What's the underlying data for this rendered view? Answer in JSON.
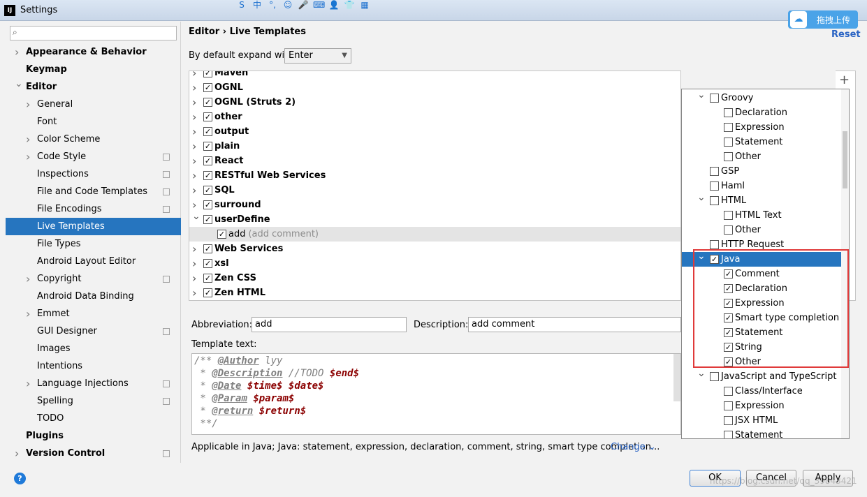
{
  "window": {
    "title": "Settings",
    "app_icon_text": "IJ",
    "ime_glyphs": [
      "S",
      "中",
      "°,",
      "☺",
      "🎤",
      "⌨",
      "👤",
      "👕",
      "▦"
    ],
    "upload_label": "拖拽上传"
  },
  "sidebar": {
    "search_placeholder": "",
    "items": [
      {
        "label": "Appearance & Behavior",
        "level": 0,
        "expand": "collapsed",
        "bold": true
      },
      {
        "label": "Keymap",
        "level": 0,
        "expand": "none",
        "bold": true
      },
      {
        "label": "Editor",
        "level": 0,
        "expand": "expanded",
        "bold": true
      },
      {
        "label": "General",
        "level": 1,
        "expand": "collapsed"
      },
      {
        "label": "Font",
        "level": 1,
        "expand": "none"
      },
      {
        "label": "Color Scheme",
        "level": 1,
        "expand": "collapsed"
      },
      {
        "label": "Code Style",
        "level": 1,
        "expand": "collapsed",
        "copy_icon": true
      },
      {
        "label": "Inspections",
        "level": 1,
        "expand": "none",
        "copy_icon": true
      },
      {
        "label": "File and Code Templates",
        "level": 1,
        "expand": "none",
        "copy_icon": true
      },
      {
        "label": "File Encodings",
        "level": 1,
        "expand": "none",
        "copy_icon": true
      },
      {
        "label": "Live Templates",
        "level": 1,
        "expand": "none",
        "selected": true
      },
      {
        "label": "File Types",
        "level": 1,
        "expand": "none"
      },
      {
        "label": "Android Layout Editor",
        "level": 1,
        "expand": "none"
      },
      {
        "label": "Copyright",
        "level": 1,
        "expand": "collapsed",
        "copy_icon": true
      },
      {
        "label": "Android Data Binding",
        "level": 1,
        "expand": "none"
      },
      {
        "label": "Emmet",
        "level": 1,
        "expand": "collapsed"
      },
      {
        "label": "GUI Designer",
        "level": 1,
        "expand": "none",
        "copy_icon": true
      },
      {
        "label": "Images",
        "level": 1,
        "expand": "none"
      },
      {
        "label": "Intentions",
        "level": 1,
        "expand": "none"
      },
      {
        "label": "Language Injections",
        "level": 1,
        "expand": "collapsed",
        "copy_icon": true
      },
      {
        "label": "Spelling",
        "level": 1,
        "expand": "none",
        "copy_icon": true
      },
      {
        "label": "TODO",
        "level": 1,
        "expand": "none"
      },
      {
        "label": "Plugins",
        "level": 0,
        "expand": "none",
        "bold": true
      },
      {
        "label": "Version Control",
        "level": 0,
        "expand": "collapsed",
        "bold": true,
        "copy_icon": true
      }
    ]
  },
  "main": {
    "breadcrumb": "Editor  ›  Live Templates",
    "reset_label": "Reset",
    "expand_label": "By default expand with",
    "expand_value": "Enter",
    "templates": [
      {
        "label": "Maven",
        "checked": true,
        "expand": "collapsed"
      },
      {
        "label": "OGNL",
        "checked": true,
        "expand": "collapsed"
      },
      {
        "label": "OGNL (Struts 2)",
        "checked": true,
        "expand": "collapsed"
      },
      {
        "label": "other",
        "checked": true,
        "expand": "collapsed"
      },
      {
        "label": "output",
        "checked": true,
        "expand": "collapsed"
      },
      {
        "label": "plain",
        "checked": true,
        "expand": "collapsed"
      },
      {
        "label": "React",
        "checked": true,
        "expand": "collapsed"
      },
      {
        "label": "RESTful Web Services",
        "checked": true,
        "expand": "collapsed"
      },
      {
        "label": "SQL",
        "checked": true,
        "expand": "collapsed"
      },
      {
        "label": "surround",
        "checked": true,
        "expand": "collapsed"
      },
      {
        "label": "userDefine",
        "checked": true,
        "expand": "expanded"
      },
      {
        "label": "add",
        "hint": "(add comment)",
        "checked": true,
        "child": true
      },
      {
        "label": "Web Services",
        "checked": true,
        "expand": "collapsed"
      },
      {
        "label": "xsl",
        "checked": true,
        "expand": "collapsed"
      },
      {
        "label": "Zen CSS",
        "checked": true,
        "expand": "collapsed"
      },
      {
        "label": "Zen HTML",
        "checked": true,
        "expand": "collapsed"
      }
    ],
    "abbreviation_label": "Abbreviation:",
    "abbreviation_value": "add",
    "description_label": "Description:",
    "description_value": "add comment",
    "template_text_label": "Template text:",
    "template_lines": [
      [
        {
          "t": "/** ",
          "c": "c-grey"
        },
        {
          "t": "@Author",
          "c": "c-tag"
        },
        {
          "t": " lyy",
          "c": "c-grey"
        }
      ],
      [
        {
          "t": " * ",
          "c": "c-grey"
        },
        {
          "t": "@Description",
          "c": "c-tag"
        },
        {
          "t": " //TODO ",
          "c": "c-grey"
        },
        {
          "t": "$end$",
          "c": "c-var"
        }
      ],
      [
        {
          "t": " * ",
          "c": "c-grey"
        },
        {
          "t": "@Date",
          "c": "c-tag"
        },
        {
          "t": " ",
          "c": "c-grey"
        },
        {
          "t": "$time$",
          "c": "c-var"
        },
        {
          "t": " ",
          "c": "c-grey"
        },
        {
          "t": "$date$",
          "c": "c-var"
        }
      ],
      [
        {
          "t": " * ",
          "c": "c-grey"
        },
        {
          "t": "@Param",
          "c": "c-tag"
        },
        {
          "t": " ",
          "c": "c-grey"
        },
        {
          "t": "$param$",
          "c": "c-var"
        }
      ],
      [
        {
          "t": " * ",
          "c": "c-grey"
        },
        {
          "t": "@return",
          "c": "c-tag"
        },
        {
          "t": " ",
          "c": "c-grey"
        },
        {
          "t": "$return$",
          "c": "c-var"
        }
      ],
      [
        {
          "t": " **/",
          "c": "c-grey"
        }
      ]
    ],
    "applicable_text": "Applicable in Java; Java: statement, expression, declaration, comment, string, smart type completion...",
    "change_label": "Change ⌄"
  },
  "context_popup": {
    "items": [
      {
        "label": "Groovy",
        "level": 0,
        "expand": "expanded",
        "checked": false
      },
      {
        "label": "Declaration",
        "level": 1,
        "checked": false
      },
      {
        "label": "Expression",
        "level": 1,
        "checked": false
      },
      {
        "label": "Statement",
        "level": 1,
        "checked": false
      },
      {
        "label": "Other",
        "level": 1,
        "checked": false
      },
      {
        "label": "GSP",
        "level": 0,
        "checked": false
      },
      {
        "label": "Haml",
        "level": 0,
        "checked": false
      },
      {
        "label": "HTML",
        "level": 0,
        "expand": "expanded",
        "checked": false
      },
      {
        "label": "HTML Text",
        "level": 1,
        "checked": false
      },
      {
        "label": "Other",
        "level": 1,
        "checked": false
      },
      {
        "label": "HTTP Request",
        "level": 0,
        "checked": false
      },
      {
        "label": "Java",
        "level": 0,
        "expand": "expanded",
        "checked": true,
        "selected": true
      },
      {
        "label": "Comment",
        "level": 1,
        "checked": true
      },
      {
        "label": "Declaration",
        "level": 1,
        "checked": true
      },
      {
        "label": "Expression",
        "level": 1,
        "checked": true
      },
      {
        "label": "Smart type completion",
        "level": 1,
        "checked": true
      },
      {
        "label": "Statement",
        "level": 1,
        "checked": true
      },
      {
        "label": "String",
        "level": 1,
        "checked": true
      },
      {
        "label": "Other",
        "level": 1,
        "checked": true
      },
      {
        "label": "JavaScript and TypeScript",
        "level": 0,
        "expand": "expanded",
        "checked": false
      },
      {
        "label": "Class/Interface",
        "level": 1,
        "checked": false
      },
      {
        "label": "Expression",
        "level": 1,
        "checked": false
      },
      {
        "label": "JSX HTML",
        "level": 1,
        "checked": false
      },
      {
        "label": "Statement",
        "level": 1,
        "checked": false
      }
    ]
  },
  "buttons": {
    "ok": "OK",
    "cancel": "Cancel",
    "apply": "Apply"
  },
  "watermark": "https://blog.csdn.net/qq_39843421",
  "colors": {
    "selection": "#2675bf",
    "highlight_box": "#e03a3a",
    "link": "#2a64c4"
  }
}
